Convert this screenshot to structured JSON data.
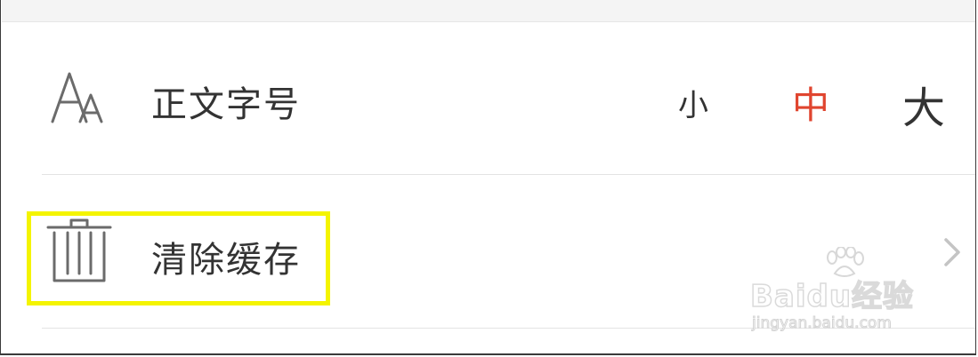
{
  "settings": {
    "font_size": {
      "label": "正文字号",
      "icon": "font-size-icon",
      "options": [
        "小",
        "中",
        "大"
      ],
      "selected_index": 1
    },
    "clear_cache": {
      "label": "清除缓存",
      "icon": "trash-icon"
    }
  },
  "colors": {
    "text": "#333333",
    "selected": "#e0452f",
    "icon": "#6b6b6b",
    "highlight": "#f4f400"
  },
  "watermark": {
    "brand": "Baidu经验",
    "url": "jingyan.baidu.com"
  }
}
